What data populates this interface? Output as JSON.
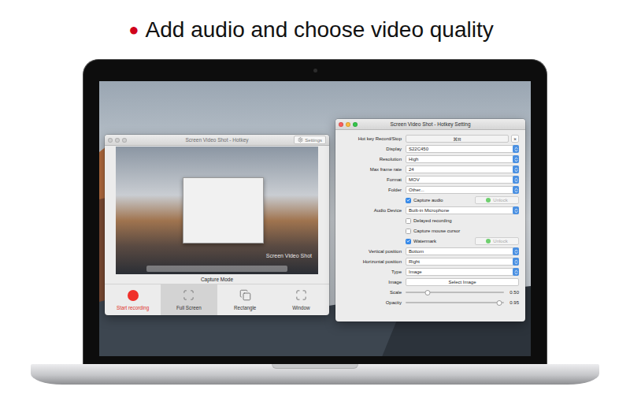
{
  "headline": {
    "bullet": "●",
    "text": "Add audio and choose video quality"
  },
  "capture_window": {
    "title": "Screen Video Shot - Hotkey",
    "active": false,
    "settings_button": "Settings",
    "preview": {
      "watermark": "Screen Video Shot"
    },
    "capture_mode_label": "Capture Mode",
    "modes": [
      {
        "label": "Start recording",
        "kind": "record",
        "selected": false
      },
      {
        "label": "Full Screen",
        "kind": "fullscreen",
        "selected": true
      },
      {
        "label": "Rectangle",
        "kind": "rectangle",
        "selected": false
      },
      {
        "label": "Window",
        "kind": "window",
        "selected": false
      }
    ]
  },
  "settings_window": {
    "title": "Screen Video Shot - Hotkey Setting",
    "active": true,
    "rows": [
      {
        "kind": "hotkey",
        "label": "Hot key Record/Stop",
        "value": "⌘R",
        "clear": "×"
      },
      {
        "kind": "select",
        "label": "Display",
        "value": "S22C450"
      },
      {
        "kind": "select",
        "label": "Resolution",
        "value": "High"
      },
      {
        "kind": "select",
        "label": "Max frame rate",
        "value": "24"
      },
      {
        "kind": "select",
        "label": "Format",
        "value": "MOV"
      },
      {
        "kind": "select",
        "label": "Folder",
        "value": "Other..."
      },
      {
        "kind": "checkbox",
        "text": "Capture audio",
        "checked": true,
        "button": {
          "label": "Unlock",
          "disabled": true
        }
      },
      {
        "kind": "select",
        "label": "Audio Device",
        "value": "Built-in Microphone"
      },
      {
        "kind": "checkbox",
        "text": "Delayed recording",
        "checked": false
      },
      {
        "kind": "checkbox",
        "text": "Capture mouse cursor",
        "checked": false
      },
      {
        "kind": "checkbox",
        "text": "Watermark",
        "checked": true,
        "button": {
          "label": "Unlock",
          "disabled": true
        }
      },
      {
        "kind": "select",
        "label": "Vertical position",
        "value": "Bottom"
      },
      {
        "kind": "select",
        "label": "Horizontal position",
        "value": "Right"
      },
      {
        "kind": "select",
        "label": "Type",
        "value": "Image"
      },
      {
        "kind": "button",
        "label": "Image",
        "value": "Select Image"
      },
      {
        "kind": "slider",
        "label": "Scale",
        "level": 0.22,
        "reading": "0.50"
      },
      {
        "kind": "slider",
        "label": "Opacity",
        "level": 0.95,
        "reading": "0.95"
      }
    ]
  }
}
